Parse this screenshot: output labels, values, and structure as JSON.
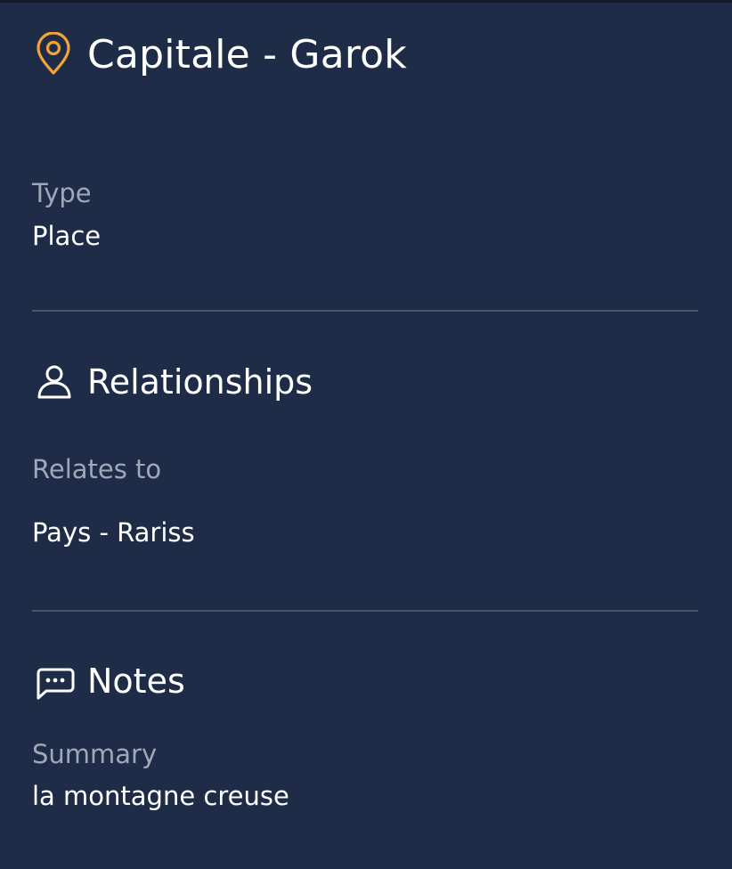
{
  "header": {
    "icon": "map-pin-icon",
    "title": "Capitale - Garok",
    "accent_color": "#f0a33a"
  },
  "details": {
    "type_label": "Type",
    "type_value": "Place"
  },
  "relationships": {
    "icon": "person-icon",
    "title": "Relationships",
    "relates_label": "Relates to",
    "relates_value": "Pays - Rariss"
  },
  "notes": {
    "icon": "chat-bubble-icon",
    "title": "Notes",
    "summary_label": "Summary",
    "summary_value": "la montagne creuse"
  },
  "colors": {
    "background": "#1f2c47",
    "text": "#ffffff",
    "muted_text": "#a0a8b8",
    "divider": "#4a5670"
  }
}
